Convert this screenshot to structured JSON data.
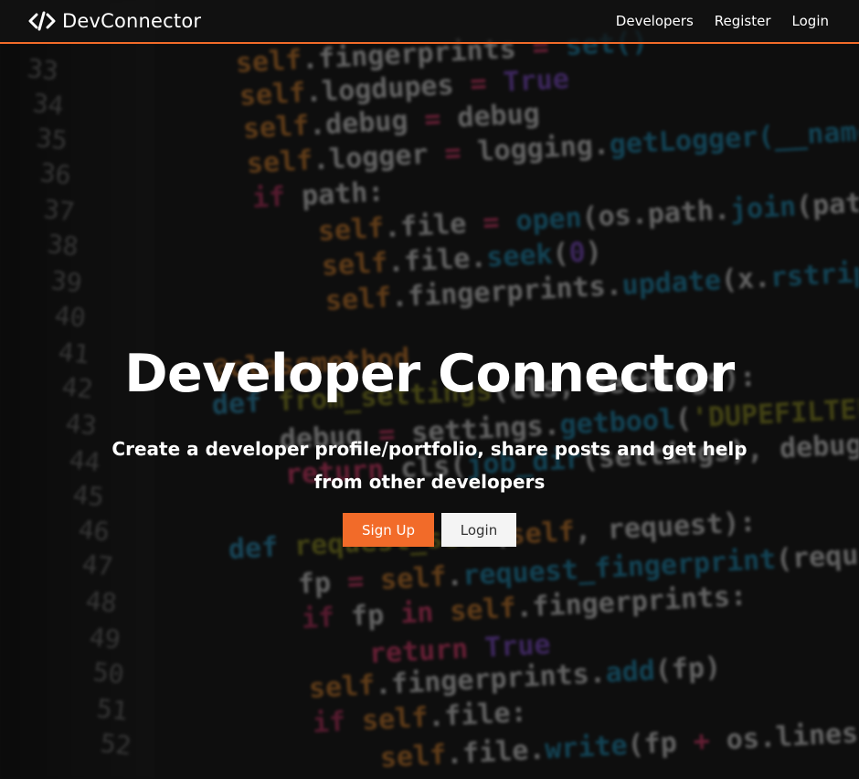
{
  "navbar": {
    "brand_icon": "code-icon",
    "brand_text": "DevConnector",
    "links": [
      {
        "label": "Developers"
      },
      {
        "label": "Register"
      },
      {
        "label": "Login"
      }
    ]
  },
  "hero": {
    "title": "Developer Connector",
    "lead": "Create a developer profile/portfolio, share posts and get help from other developers",
    "buttons": {
      "signup_label": "Sign Up",
      "login_label": "Login"
    }
  },
  "colors": {
    "accent": "#f26b29",
    "navbar_bg": "#141414",
    "text": "#ffffff",
    "light_button": "#f4f4f4"
  }
}
